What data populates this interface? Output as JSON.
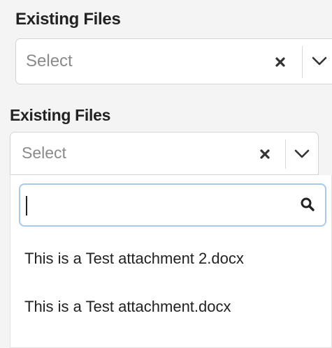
{
  "top_field": {
    "label": "Existing Files",
    "placeholder": "Select"
  },
  "open_field": {
    "label": "Existing Files",
    "placeholder": "Select",
    "search": {
      "value": ""
    },
    "options": [
      "This is a Test attachment 2.docx",
      "This is a Test attachment.docx"
    ]
  },
  "icons": {
    "clear": "close-icon",
    "dropdown": "chevron-down-icon",
    "search": "search-icon"
  },
  "colors": {
    "focus_border": "#a9c9ec",
    "placeholder": "#8a8a8a"
  }
}
